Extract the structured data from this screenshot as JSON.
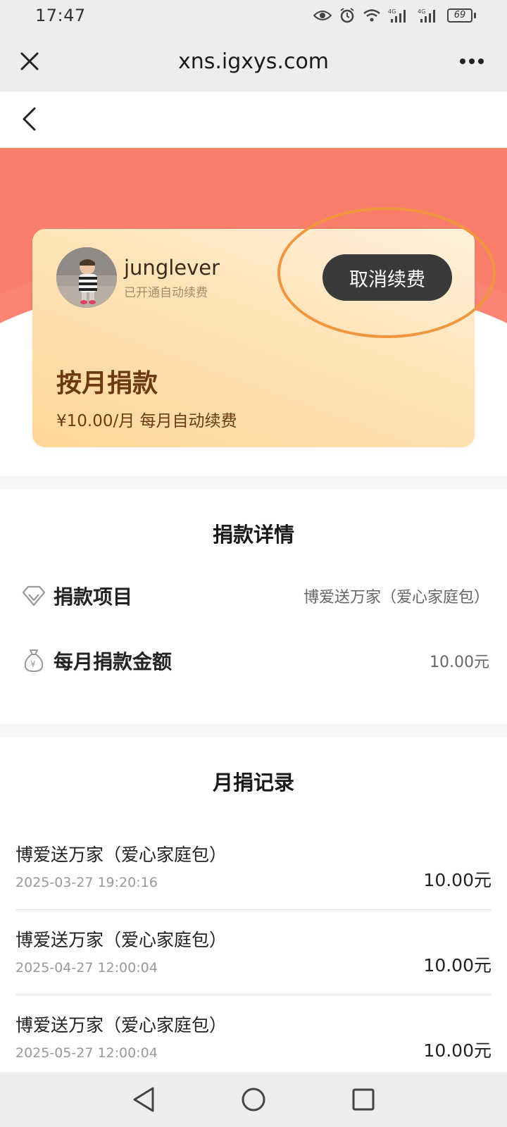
{
  "status_bar": {
    "time": "17:47",
    "battery": "69",
    "icons": [
      "eye-icon",
      "alarm-icon",
      "wifi-icon",
      "signal-4g-icon",
      "signal-4g-icon",
      "battery-icon"
    ]
  },
  "browser": {
    "title": "xns.igxys.com",
    "close_icon": "close-icon",
    "more_icon": "more-icon"
  },
  "subscription_card": {
    "username": "junglever",
    "status": "已开通自动续费",
    "cancel_label": "取消续费",
    "plan_title": "按月捐款",
    "plan_desc": "¥10.00/月 每月自动续费"
  },
  "donation_details": {
    "title": "捐款详情",
    "rows": [
      {
        "icon": "diamond-icon",
        "label": "捐款项目",
        "value": "博爱送万家（爱心家庭包）"
      },
      {
        "icon": "money-bag-icon",
        "label": "每月捐款金额",
        "value": "10.00元"
      }
    ]
  },
  "monthly_records": {
    "title": "月捐记录",
    "items": [
      {
        "name": "博爱送万家（爱心家庭包）",
        "date": "2025-03-27 19:20:16",
        "amount": "10.00元"
      },
      {
        "name": "博爱送万家（爱心家庭包）",
        "date": "2025-04-27 12:00:04",
        "amount": "10.00元"
      },
      {
        "name": "博爱送万家（爱心家庭包）",
        "date": "2025-05-27 12:00:04",
        "amount": "10.00元"
      }
    ]
  },
  "colors": {
    "banner": "#f97e6c",
    "card_gradient_start": "#fff1dc",
    "card_gradient_end": "#ffd699",
    "cancel_button": "#3a3a3a",
    "highlight_ring": "#f0963f",
    "plan_text": "#6a3a10"
  }
}
